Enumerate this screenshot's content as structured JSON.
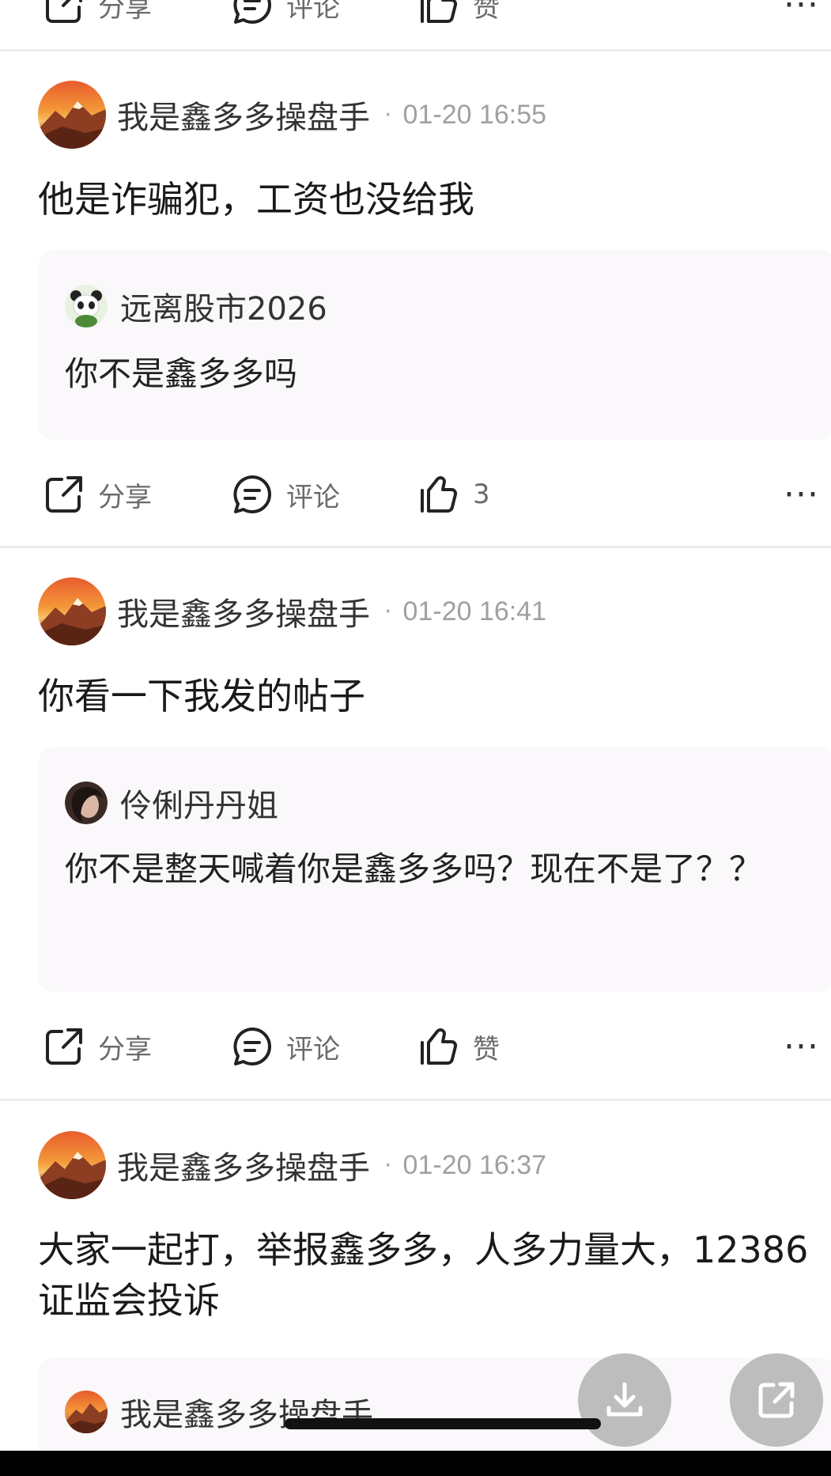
{
  "actions_labels": {
    "share": "分享",
    "comment": "评论",
    "like_default": "赞"
  },
  "top_partial": {
    "share": "分享",
    "comment": "评论",
    "like": "赞",
    "more": "···"
  },
  "posts": [
    {
      "author": "我是鑫多多操盘手",
      "time": "01-20 16:55",
      "text": "他是诈骗犯，工资也没给我",
      "quote": {
        "name": "远离股市2026",
        "text": "你不是鑫多多吗",
        "avatar_icon": "panda-avatar-icon"
      },
      "like": "3",
      "more": "···"
    },
    {
      "author": "我是鑫多多操盘手",
      "time": "01-20 16:41",
      "text": "你看一下我发的帖子",
      "quote": {
        "name": "伶俐丹丹姐",
        "text": "你不是整天喊着你是鑫多多吗？现在不是了？？",
        "avatar_icon": "woman-avatar-icon"
      },
      "like": "赞",
      "more": "···"
    },
    {
      "author": "我是鑫多多操盘手",
      "time": "01-20 16:37",
      "text": "大家一起打，举报鑫多多，人多力量大，12386证监会投诉",
      "quote": {
        "name": "我是鑫多多操盘手",
        "text": "",
        "avatar_icon": "mountain-avatar-icon"
      }
    }
  ],
  "fabs": {
    "download_icon": "download-icon",
    "share_icon": "external-share-icon"
  },
  "colors": {
    "quote_bg": "#fbf8fb",
    "divider": "#ebebeb",
    "muted_text": "#a0a0a0",
    "fab_bg": "#bdbdbd"
  }
}
